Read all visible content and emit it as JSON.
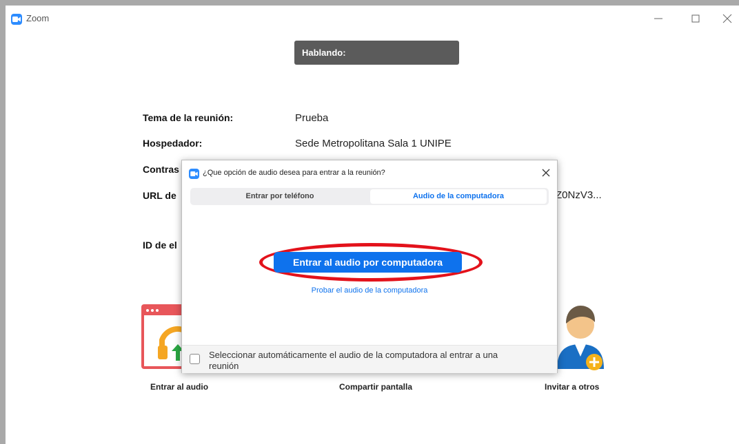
{
  "window": {
    "title": "Zoom"
  },
  "speaking_banner": {
    "label": "Hablando:"
  },
  "meeting_info": {
    "topic_label": "Tema de la reunión:",
    "topic_value": "Prueba",
    "host_label": "Hospedador:",
    "host_value": "Sede Metropolitana Sala 1 UNIPE",
    "password_label_visible": "Contras",
    "url_label_visible": "URL de",
    "url_value_visible": "Z0NzV3...",
    "id_label_visible": "ID de el"
  },
  "actions": {
    "audio_label": "Entrar al audio",
    "share_label": "Compartir pantalla",
    "invite_label": "Invitar a otros"
  },
  "dialog": {
    "title": "¿Que opción de audio desea para entrar a la reunión?",
    "tabs": [
      {
        "label": "Entrar por teléfono",
        "selected": false
      },
      {
        "label": "Audio de la computadora",
        "selected": true
      }
    ],
    "join_button": "Entrar al audio por computadora",
    "test_link": "Probar el audio de la computadora",
    "auto_select_checkbox": {
      "label": "Seleccionar automáticamente el audio de la computadora al entrar a una reunión",
      "checked": false
    }
  },
  "colors": {
    "accent": "#0e72ed",
    "banner": "#5b5b5b",
    "highlight_oval": "#e3121b",
    "audio_icon": "#e8565a",
    "frame": "#a9a9a9"
  },
  "icons": {
    "app": "zoom-camera-icon",
    "close": "close-icon",
    "audio": "headphones-icon",
    "invite": "invite-person-icon"
  }
}
